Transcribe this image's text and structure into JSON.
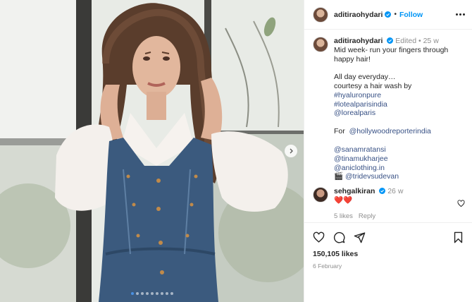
{
  "post": {
    "username": "aditiraohydari",
    "follow_label": "Follow",
    "separator": "•",
    "caption": {
      "username": "aditiraohydari",
      "edited": "Edited",
      "time": "25 w",
      "text": "Mid week- run your fingers through happy hair!\n\nAll day everyday…\ncourtesy a hair wash by",
      "hashtags": [
        "#hyaluronpure",
        "#lotealparisindia"
      ],
      "mention_loreal": "@lorealparis",
      "for_label": "For",
      "mention_for": "@hollywoodreporterindia",
      "credits": [
        "@sanamratansi",
        "@tinamukharjee",
        "@aniclothing.in"
      ],
      "last_credit_prefix": "🎬",
      "last_credit": "@tridevsudevan"
    },
    "comment": {
      "username": "sehgalkiran",
      "time": "26 w",
      "text": "❤️❤️",
      "likes": "5 likes",
      "reply": "Reply"
    },
    "likes_count": "150,105 likes",
    "date": "6 February",
    "carousel_dots": 9,
    "carousel_active": 0,
    "colors": {
      "link": "#385185",
      "follow": "#0095f6",
      "verified": "#0095f6"
    }
  }
}
